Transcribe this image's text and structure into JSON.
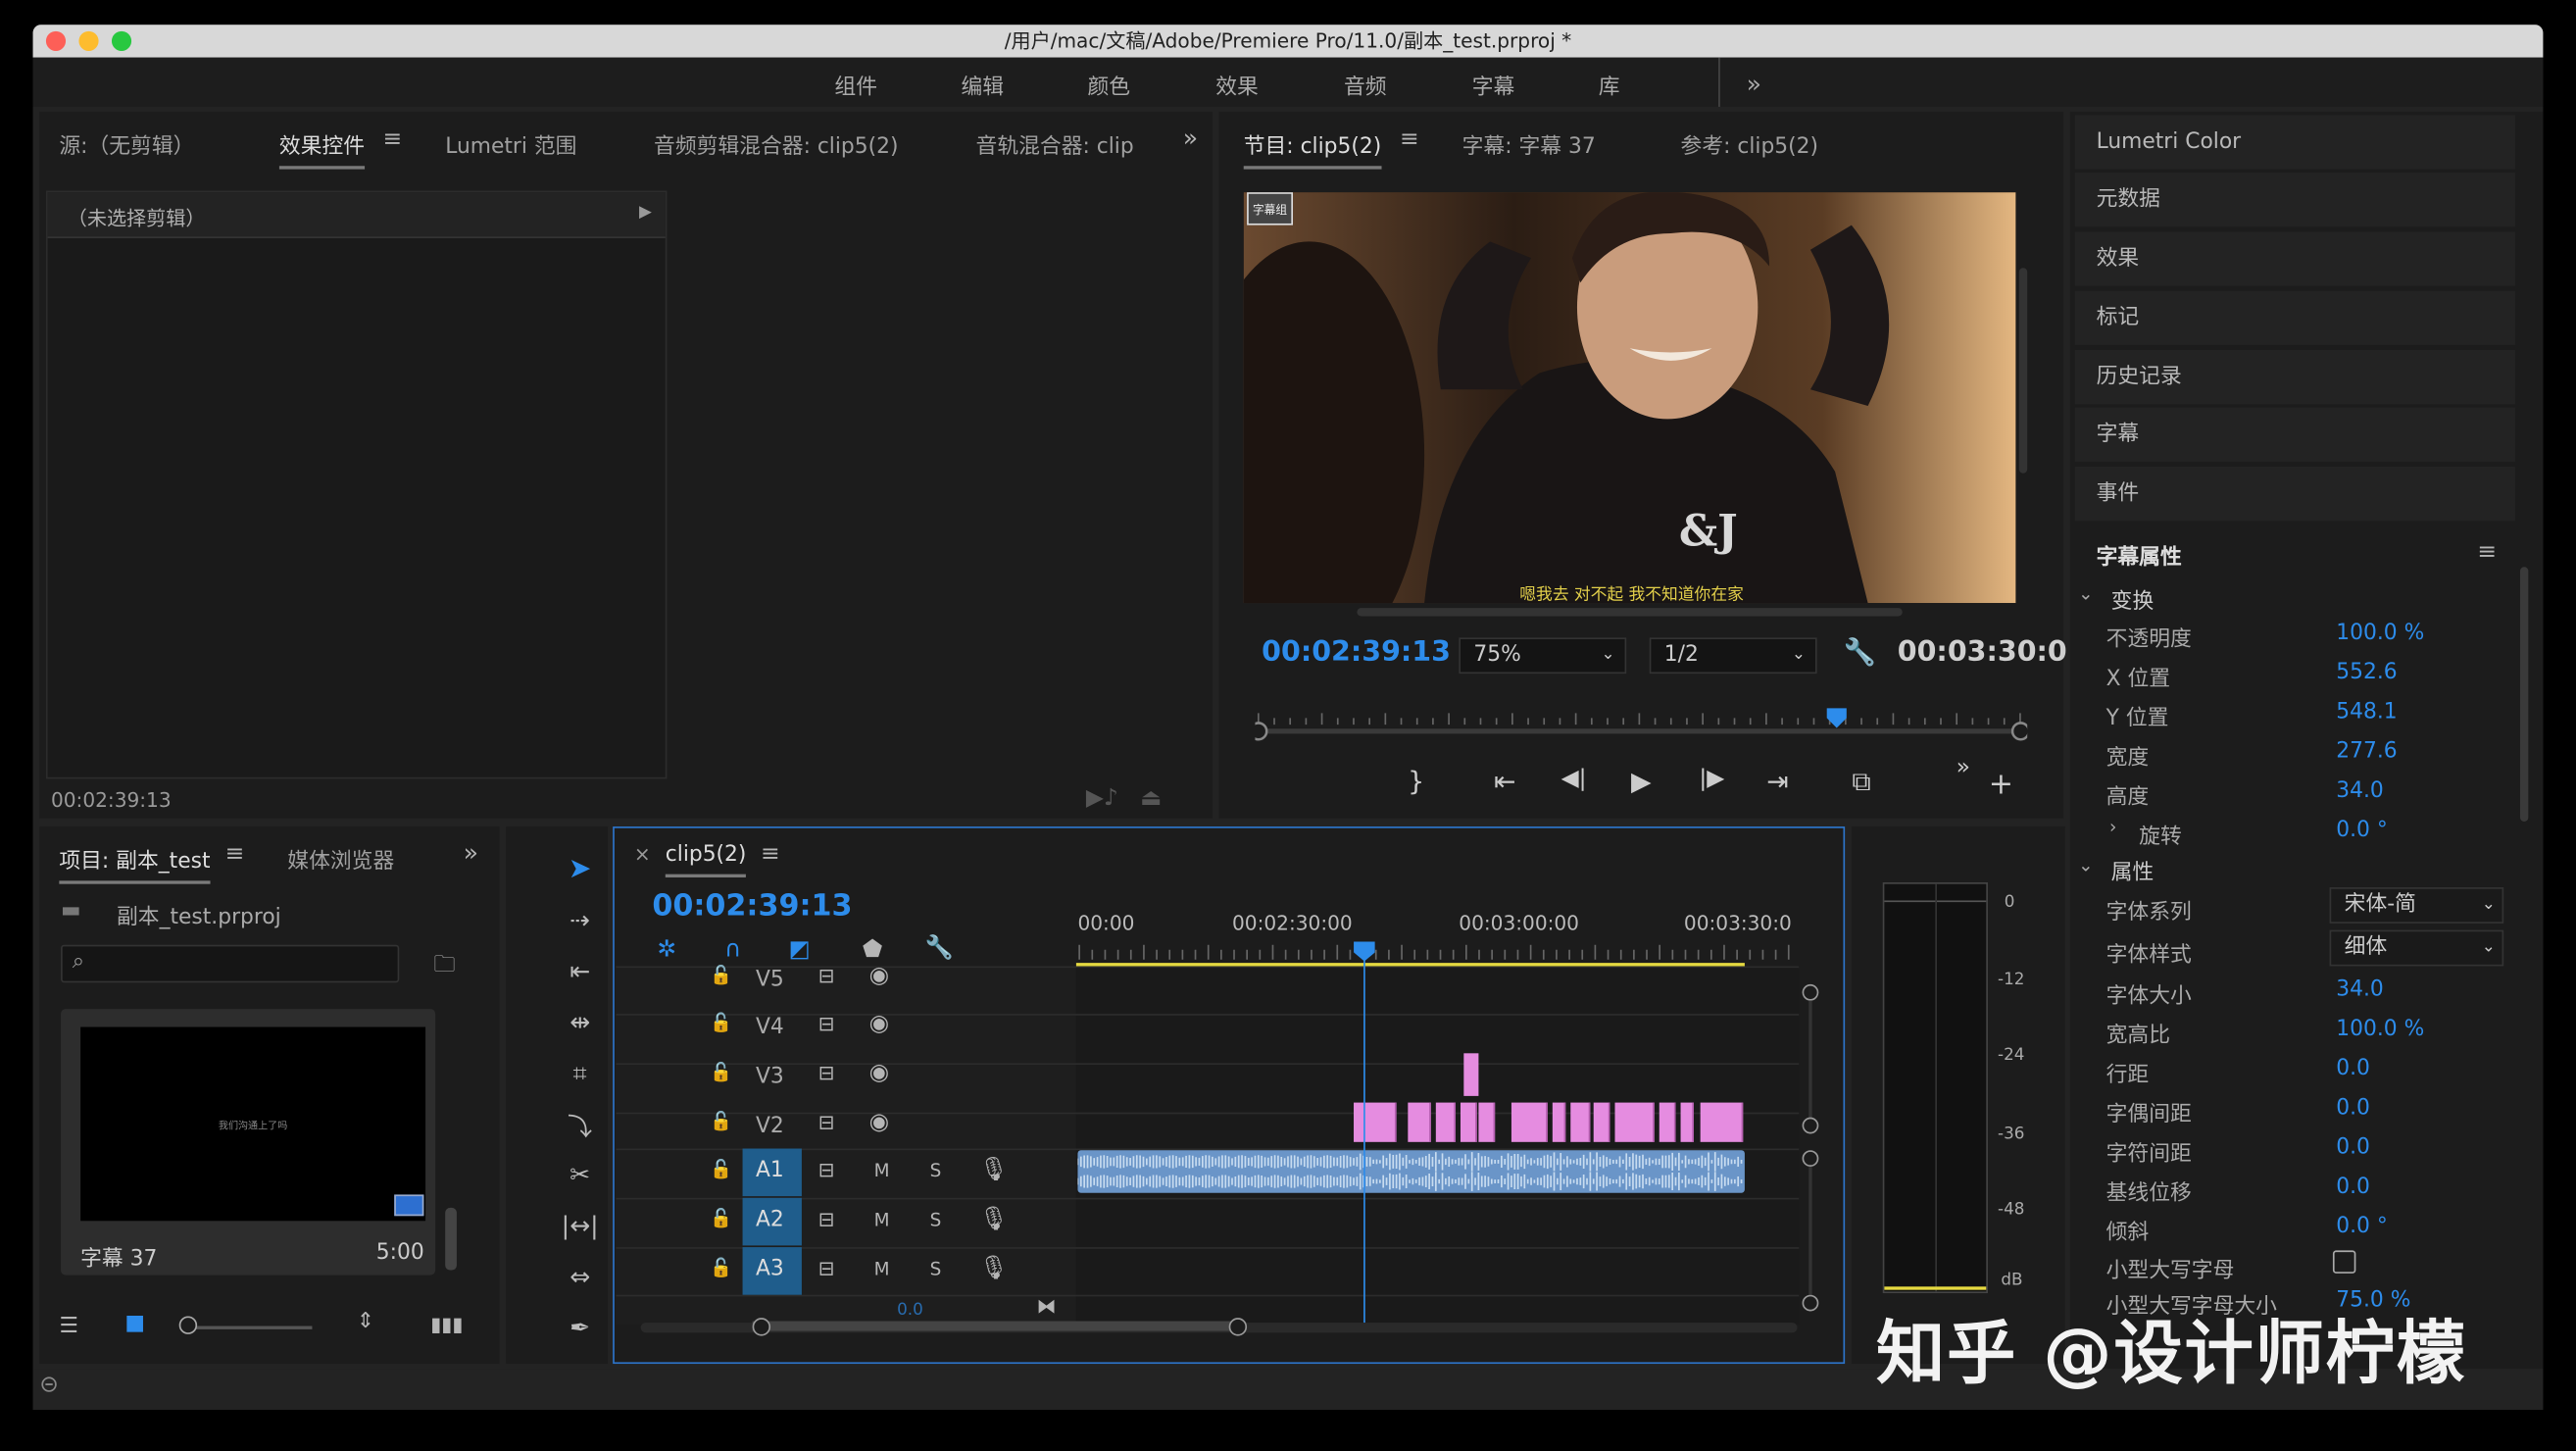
{
  "window": {
    "title": "/用户/mac/文稿/Adobe/Premiere Pro/11.0/副本_test.prproj *"
  },
  "workspaces": [
    "组件",
    "编辑",
    "颜色",
    "效果",
    "音频",
    "字幕",
    "库"
  ],
  "top_left_tabs": [
    "源:（无剪辑）",
    "效果控件",
    "Lumetri 范围",
    "音频剪辑混合器: clip5(2)",
    "音轨混合器: clip"
  ],
  "effect_controls": {
    "no_clip": "（未选择剪辑）",
    "timecode": "00:02:39:13"
  },
  "program": {
    "tabs": [
      "节目: clip5(2)",
      "字幕: 字幕 37",
      "参考: clip5(2)"
    ],
    "timecode": "00:02:39:13",
    "zoom": "75%",
    "resolution": "1/2",
    "duration": "00:03:30:0",
    "subtitle_text": "嗯我去 对不起 我不知道你在家",
    "overlay_logo": "字幕组"
  },
  "right_panels": [
    "Lumetri Color",
    "元数据",
    "效果",
    "标记",
    "历史记录",
    "字幕",
    "事件"
  ],
  "caption_props": {
    "title": "字幕属性",
    "transform": "变换",
    "attributes": "属性",
    "rows": [
      {
        "label": "不透明度",
        "value": "100.0 %"
      },
      {
        "label": "X 位置",
        "value": "552.6"
      },
      {
        "label": "Y 位置",
        "value": "548.1"
      },
      {
        "label": "宽度",
        "value": "277.6"
      },
      {
        "label": "高度",
        "value": "34.0"
      },
      {
        "label": "旋转",
        "value": "0.0 °"
      }
    ],
    "font_family_label": "字体系列",
    "font_family": "宋体-简",
    "font_style_label": "字体样式",
    "font_style": "细体",
    "rows2": [
      {
        "label": "字体大小",
        "value": "34.0"
      },
      {
        "label": "宽高比",
        "value": "100.0 %"
      },
      {
        "label": "行距",
        "value": "0.0"
      },
      {
        "label": "字偶间距",
        "value": "0.0"
      },
      {
        "label": "字符间距",
        "value": "0.0"
      },
      {
        "label": "基线位移",
        "value": "0.0"
      },
      {
        "label": "倾斜",
        "value": "0.0 °"
      }
    ],
    "smallcaps_label": "小型大写字母",
    "smallcaps_size_label": "小型大写字母大小",
    "smallcaps_size": "75.0 %"
  },
  "project": {
    "tabs": [
      "项目: 副本_test",
      "媒体浏览器"
    ],
    "file": "副本_test.prproj",
    "thumb_caption": "字幕 37",
    "thumb_duration": "5:00",
    "thumb_inner_text": "我们沟通上了吗"
  },
  "timeline": {
    "tab": "clip5(2)",
    "timecode": "00:02:39:13",
    "ruler": [
      "00:00",
      "00:02:30:00",
      "00:03:00:00",
      "00:03:30:0"
    ],
    "video_tracks": [
      "V5",
      "V4",
      "V3",
      "V2"
    ],
    "audio_tracks": [
      "A1",
      "A2",
      "A3"
    ],
    "mute": "M",
    "solo": "S",
    "vol_value": "0.0"
  },
  "meter": {
    "labels": [
      "0",
      "-12",
      "-24",
      "-36",
      "-48",
      "dB"
    ]
  },
  "watermark": "知乎 @设计师柠檬",
  "colors": {
    "accent": "#2d8ceb",
    "clip_pink": "#e58ce0",
    "audio_blue": "#6a95c8",
    "in_out_yellow": "#e5d940"
  }
}
